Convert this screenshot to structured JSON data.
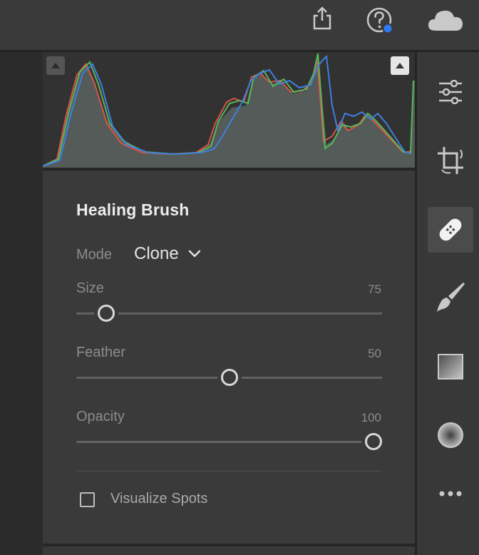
{
  "topbar": {
    "share_icon": "share-icon",
    "help_icon": "help-icon",
    "help_badge_color": "#2f7bf5",
    "cloud_icon": "cloud-icon"
  },
  "histogram": {
    "clip_shadows_icon": "triangle-up-icon",
    "clip_highlights_icon": "triangle-up-icon",
    "channels": [
      "red",
      "green",
      "blue"
    ]
  },
  "tools": [
    {
      "name": "edit-icon"
    },
    {
      "name": "crop-icon"
    },
    {
      "name": "healing-icon",
      "active": true
    },
    {
      "name": "brush-icon"
    },
    {
      "name": "linear-gradient-icon"
    },
    {
      "name": "radial-gradient-icon"
    },
    {
      "name": "more-icon"
    }
  ],
  "panel": {
    "title": "Healing Brush",
    "mode_label": "Mode",
    "mode_value": "Clone",
    "sliders": [
      {
        "label": "Size",
        "value": "75",
        "position": 0.1
      },
      {
        "label": "Feather",
        "value": "50",
        "position": 0.5
      },
      {
        "label": "Opacity",
        "value": "100",
        "position": 0.97
      }
    ],
    "checkbox_label": "Visualize Spots",
    "checkbox_checked": false
  },
  "colors": {
    "accent_blue": "#2f7bf5",
    "hist_red": "#d9534a",
    "hist_green": "#55b85a",
    "hist_blue": "#3f7fe0"
  }
}
